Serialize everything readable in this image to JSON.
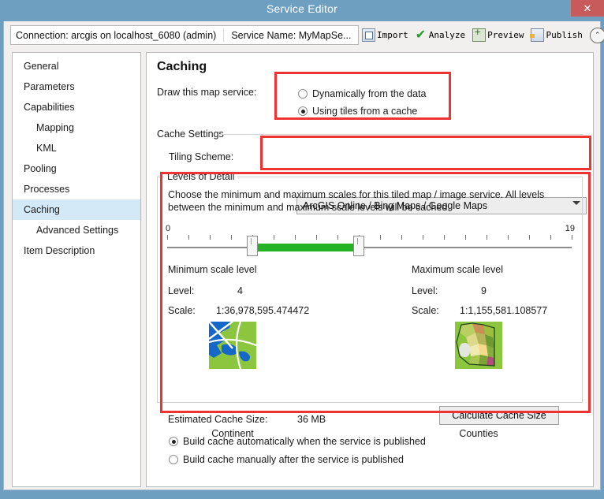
{
  "window": {
    "title": "Service Editor",
    "close_label": "✕"
  },
  "toolbar": {
    "connection": "Connection: arcgis on localhost_6080 (admin)",
    "service_name": "Service Name: MyMapSe...",
    "actions": [
      {
        "label": "Import",
        "icon": "import-icon"
      },
      {
        "label": "Analyze",
        "icon": "check-icon"
      },
      {
        "label": "Preview",
        "icon": "preview-icon"
      },
      {
        "label": "Publish",
        "icon": "publish-icon"
      }
    ],
    "collapse_label": "⌃"
  },
  "sidebar": {
    "items": [
      {
        "label": "General",
        "indent": false,
        "selected": false
      },
      {
        "label": "Parameters",
        "indent": false,
        "selected": false
      },
      {
        "label": "Capabilities",
        "indent": false,
        "selected": false
      },
      {
        "label": "Mapping",
        "indent": true,
        "selected": false
      },
      {
        "label": "KML",
        "indent": true,
        "selected": false
      },
      {
        "label": "Pooling",
        "indent": false,
        "selected": false
      },
      {
        "label": "Processes",
        "indent": false,
        "selected": false
      },
      {
        "label": "Caching",
        "indent": false,
        "selected": true
      },
      {
        "label": "Advanced Settings",
        "indent": true,
        "selected": false
      },
      {
        "label": "Item Description",
        "indent": false,
        "selected": false
      }
    ]
  },
  "main": {
    "page_title": "Caching",
    "draw_label": "Draw this map service:",
    "draw_options": [
      {
        "label": "Dynamically from the data",
        "checked": false
      },
      {
        "label": "Using tiles from a cache",
        "checked": true
      }
    ],
    "cache_settings_label": "Cache Settings",
    "tiling_scheme_label": "Tiling Scheme:",
    "tiling_scheme_value": "ArcGIS Online / Bing Maps / Google Maps",
    "levels_of_detail": {
      "group_title": "Levels of Detail",
      "description": "Choose the minimum and maximum scales for this tiled map / image service. All levels between the minimum and maximum scale levels will be cached.",
      "slider": {
        "min_tick_label": "0",
        "max_tick_label": "19",
        "range_min": 0,
        "range_max": 19,
        "selected_min": 4,
        "selected_max": 9,
        "fill_color": "#22b222"
      },
      "minimum": {
        "heading": "Minimum scale level",
        "level_label": "Level:",
        "level_value": "4",
        "scale_label": "Scale:",
        "scale_value": "1:36,978,595.474472",
        "thumbnail_caption": "Continent"
      },
      "maximum": {
        "heading": "Maximum scale level",
        "level_label": "Level:",
        "level_value": "9",
        "scale_label": "Scale:",
        "scale_value": "1:1,155,581.108577",
        "thumbnail_caption": "Counties"
      }
    },
    "estimated_cache_label": "Estimated Cache Size:",
    "estimated_cache_value": "36 MB",
    "calculate_button": "Calculate Cache Size",
    "build_options": [
      {
        "label": "Build cache automatically when the service is published",
        "checked": true
      },
      {
        "label": "Build cache manually after the service is published",
        "checked": false
      }
    ]
  },
  "annotations": {
    "highlight_color": "#ef3333",
    "boxes": [
      "draw-options",
      "tiling-scheme",
      "levels-of-detail"
    ]
  }
}
